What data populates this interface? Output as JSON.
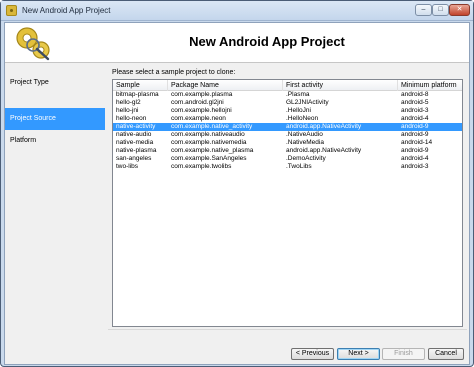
{
  "window": {
    "title": "New Android App Project",
    "min_label": "–",
    "max_label": "□",
    "close_label": "✕"
  },
  "header": {
    "title": "New Android App Project"
  },
  "nav": {
    "items": [
      {
        "label": "Project Type"
      },
      {
        "label": "Project Source"
      },
      {
        "label": "Platform"
      }
    ],
    "selected_index": 1
  },
  "main": {
    "prompt": "Please select a sample project to clone:",
    "columns": [
      "Sample",
      "Package Name",
      "First activity",
      "Minimum platform"
    ],
    "selected_row": 4,
    "rows": [
      [
        "bitmap-plasma",
        "com.example.plasma",
        ".Plasma",
        "android-8"
      ],
      [
        "hello-gl2",
        "com.android.gl2jni",
        "GL2JNIActivity",
        "android-5"
      ],
      [
        "hello-jni",
        "com.example.hellojni",
        ".HelloJni",
        "android-3"
      ],
      [
        "hello-neon",
        "com.example.neon",
        ".HelloNeon",
        "android-4"
      ],
      [
        "native-activity",
        "com.example.native_activity",
        "android.app.NativeActivity",
        "android-9"
      ],
      [
        "native-audio",
        "com.example.nativeaudio",
        ".NativeAudio",
        "android-9"
      ],
      [
        "native-media",
        "com.example.nativemedia",
        ".NativeMedia",
        "android-14"
      ],
      [
        "native-plasma",
        "com.example.native_plasma",
        "android.app.NativeActivity",
        "android-9"
      ],
      [
        "san-angeles",
        "com.example.SanAngeles",
        ".DemoActivity",
        "android-4"
      ],
      [
        "two-libs",
        "com.example.twolibs",
        ".TwoLibs",
        "android-3"
      ]
    ]
  },
  "buttons": {
    "previous": "< Previous",
    "next": "Next >",
    "finish": "Finish",
    "cancel": "Cancel"
  },
  "colors": {
    "selection": "#3399ff",
    "frame": "#c9d9ec"
  }
}
